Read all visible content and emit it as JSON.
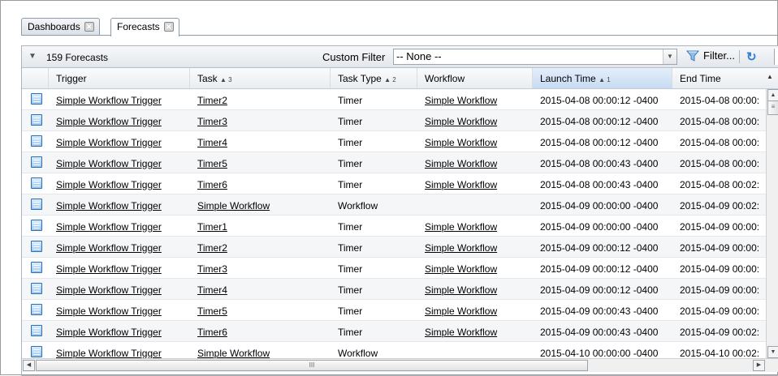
{
  "tabs": [
    {
      "label": "Dashboards",
      "active": false
    },
    {
      "label": "Forecasts",
      "active": true
    }
  ],
  "toolbar": {
    "count_label": "159 Forecasts",
    "custom_filter_label": "Custom Filter",
    "custom_filter_value": "-- None --",
    "filter_button_label": "Filter..."
  },
  "columns": [
    {
      "label": "Trigger",
      "sort": ""
    },
    {
      "label": "Task",
      "sort": "▲ 3"
    },
    {
      "label": "Task Type",
      "sort": "▲ 2"
    },
    {
      "label": "Workflow",
      "sort": ""
    },
    {
      "label": "Launch Time",
      "sort": "▲ 1"
    },
    {
      "label": "End Time",
      "sort": ""
    }
  ],
  "rows": [
    {
      "trigger": "Simple Workflow Trigger",
      "task": "Timer2",
      "task_type": "Timer",
      "workflow": "Simple Workflow",
      "launch_time": "2015-04-08 00:00:12 -0400",
      "end_time": "2015-04-08 00:00:"
    },
    {
      "trigger": "Simple Workflow Trigger",
      "task": "Timer3",
      "task_type": "Timer",
      "workflow": "Simple Workflow",
      "launch_time": "2015-04-08 00:00:12 -0400",
      "end_time": "2015-04-08 00:00:"
    },
    {
      "trigger": "Simple Workflow Trigger",
      "task": "Timer4",
      "task_type": "Timer",
      "workflow": "Simple Workflow",
      "launch_time": "2015-04-08 00:00:12 -0400",
      "end_time": "2015-04-08 00:00:"
    },
    {
      "trigger": "Simple Workflow Trigger",
      "task": "Timer5",
      "task_type": "Timer",
      "workflow": "Simple Workflow",
      "launch_time": "2015-04-08 00:00:43 -0400",
      "end_time": "2015-04-08 00:00:"
    },
    {
      "trigger": "Simple Workflow Trigger",
      "task": "Timer6",
      "task_type": "Timer",
      "workflow": "Simple Workflow",
      "launch_time": "2015-04-08 00:00:43 -0400",
      "end_time": "2015-04-08 00:02:"
    },
    {
      "trigger": "Simple Workflow Trigger",
      "task": "Simple Workflow",
      "task_type": "Workflow",
      "workflow": "",
      "launch_time": "2015-04-09 00:00:00 -0400",
      "end_time": "2015-04-09 00:02:"
    },
    {
      "trigger": "Simple Workflow Trigger",
      "task": "Timer1",
      "task_type": "Timer",
      "workflow": "Simple Workflow",
      "launch_time": "2015-04-09 00:00:00 -0400",
      "end_time": "2015-04-09 00:00:"
    },
    {
      "trigger": "Simple Workflow Trigger",
      "task": "Timer2",
      "task_type": "Timer",
      "workflow": "Simple Workflow",
      "launch_time": "2015-04-09 00:00:12 -0400",
      "end_time": "2015-04-09 00:00:"
    },
    {
      "trigger": "Simple Workflow Trigger",
      "task": "Timer3",
      "task_type": "Timer",
      "workflow": "Simple Workflow",
      "launch_time": "2015-04-09 00:00:12 -0400",
      "end_time": "2015-04-09 00:00:"
    },
    {
      "trigger": "Simple Workflow Trigger",
      "task": "Timer4",
      "task_type": "Timer",
      "workflow": "Simple Workflow",
      "launch_time": "2015-04-09 00:00:12 -0400",
      "end_time": "2015-04-09 00:00:"
    },
    {
      "trigger": "Simple Workflow Trigger",
      "task": "Timer5",
      "task_type": "Timer",
      "workflow": "Simple Workflow",
      "launch_time": "2015-04-09 00:00:43 -0400",
      "end_time": "2015-04-09 00:00:"
    },
    {
      "trigger": "Simple Workflow Trigger",
      "task": "Timer6",
      "task_type": "Timer",
      "workflow": "Simple Workflow",
      "launch_time": "2015-04-09 00:00:43 -0400",
      "end_time": "2015-04-09 00:02:"
    },
    {
      "trigger": "Simple Workflow Trigger",
      "task": "Simple Workflow",
      "task_type": "Workflow",
      "workflow": "",
      "launch_time": "2015-04-10 00:00:00 -0400",
      "end_time": "2015-04-10 00:02:"
    }
  ],
  "icons": {
    "collapse": "chevron-down-icon",
    "filter": "filter-icon",
    "refresh": "refresh-icon",
    "row": "forecast-record-icon"
  },
  "colors": {
    "sorted_header": "#c7dbf3",
    "row_icon": "#2b6fb8",
    "refresh": "#2f7fd2"
  }
}
